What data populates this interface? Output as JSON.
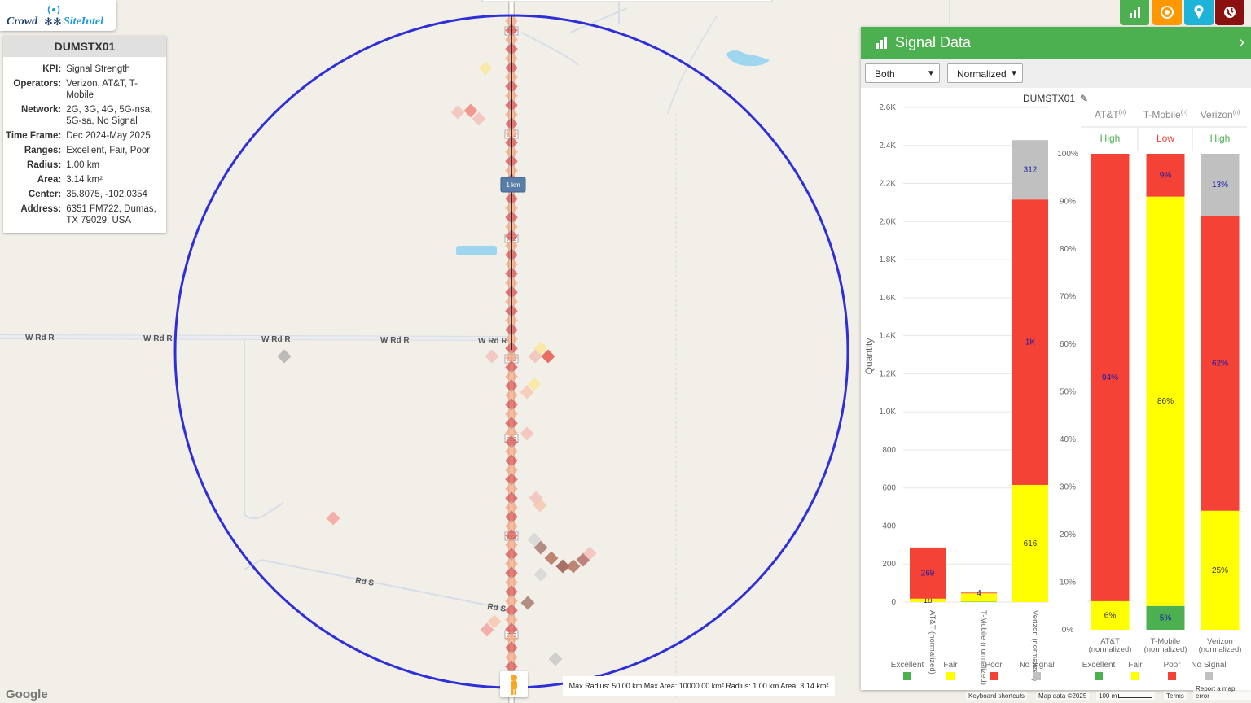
{
  "app": {
    "brand_left": "Crowd",
    "brand_right": "SiteIntel"
  },
  "site": {
    "name": "DUMSTX01",
    "rows": [
      {
        "k": "KPI:",
        "v": "Signal Strength"
      },
      {
        "k": "Operators:",
        "v": "Verizon, AT&T, T-Mobile"
      },
      {
        "k": "Network:",
        "v": "2G, 3G, 4G, 5G-nsa, 5G-sa, No Signal"
      },
      {
        "k": "Time Frame:",
        "v": "Dec 2024-May 2025"
      },
      {
        "k": "Ranges:",
        "v": "Excellent, Fair, Poor"
      },
      {
        "k": "Radius:",
        "v": "1.00 km"
      },
      {
        "k": "Area:",
        "v": "3.14 km²"
      },
      {
        "k": "Center:",
        "v": "35.8075, -102.0354"
      },
      {
        "k": "Address:",
        "v": "6351 FM722, Dumas, TX 79029, USA"
      }
    ]
  },
  "map": {
    "roads": [
      "W Rd R",
      "W Rd R",
      "W Rd R",
      "W Rd R",
      "W Rd R",
      "Rd S",
      "Rd S"
    ],
    "route_shield": "722",
    "scale_marker": "1 km",
    "bottom_note": "Max Radius: 50.00 km Max Area: 10000.00 km² Radius: 1.00 km Area: 3.14 km²",
    "attribution": {
      "shortcuts": "Keyboard shortcuts",
      "data": "Map data ©2025",
      "scale": "100 m",
      "terms": "Terms",
      "report": "Report a map error"
    },
    "google": "Google"
  },
  "topbar": {
    "icons": [
      "chart-icon",
      "target-icon",
      "pin-icon",
      "globe-icon"
    ]
  },
  "panel": {
    "title": "Signal Data",
    "filter1": "Both",
    "filter2": "Normalized",
    "site_label": "DUMSTX01"
  },
  "colors": {
    "excellent": "#4caf50",
    "fair": "#ffff00",
    "poor": "#f44336",
    "no_signal": "#c0c0c0"
  },
  "chart_data": [
    {
      "type": "bar",
      "stacked": true,
      "ylabel": "Quantity",
      "ylim": [
        0,
        2600
      ],
      "yticks": [
        "0",
        "200",
        "400",
        "600",
        "800",
        "1.0K",
        "1.2K",
        "1.4K",
        "1.6K",
        "1.8K",
        "2.0K",
        "2.2K",
        "2.4K",
        "2.6K"
      ],
      "categories": [
        "AT&T (normalized)",
        "T-Mobile (normalized)",
        "Verizon (normalized)"
      ],
      "series": [
        {
          "name": "Excellent",
          "values": [
            0,
            2,
            0
          ],
          "labels": [
            "",
            "",
            ""
          ]
        },
        {
          "name": "Fair",
          "values": [
            18,
            44,
            616
          ],
          "labels": [
            "18",
            "",
            "616"
          ]
        },
        {
          "name": "Poor",
          "values": [
            269,
            4,
            1500
          ],
          "labels": [
            "269",
            "4",
            "1K"
          ]
        },
        {
          "name": "No Signal",
          "values": [
            0,
            0,
            312
          ],
          "labels": [
            "",
            "",
            "312"
          ]
        }
      ],
      "legend": [
        "Excellent",
        "Fair",
        "Poor",
        "No Signal"
      ]
    },
    {
      "type": "bar",
      "stacked": true,
      "percent": true,
      "yticks": [
        "0%",
        "10%",
        "20%",
        "30%",
        "40%",
        "50%",
        "60%",
        "70%",
        "80%",
        "90%",
        "100%"
      ],
      "categories": [
        "AT&T (normalized)",
        "T-Mobile (normalized)",
        "Verizon (normalized)"
      ],
      "headers": [
        "AT&T",
        "T-Mobile",
        "Verizon"
      ],
      "header_sup": "(n)",
      "levels": [
        "High",
        "Low",
        "High"
      ],
      "series": [
        {
          "name": "Excellent",
          "values": [
            0,
            5,
            0
          ],
          "labels": [
            "",
            "5%",
            ""
          ]
        },
        {
          "name": "Fair",
          "values": [
            6,
            86,
            25
          ],
          "labels": [
            "6%",
            "86%",
            "25%"
          ]
        },
        {
          "name": "Poor",
          "values": [
            94,
            9,
            62
          ],
          "labels": [
            "94%",
            "9%",
            "62%"
          ]
        },
        {
          "name": "No Signal",
          "values": [
            0,
            0,
            13
          ],
          "labels": [
            "",
            "",
            "13%"
          ]
        }
      ],
      "legend": [
        "Excellent",
        "Fair",
        "Poor",
        "No Signal"
      ]
    }
  ]
}
